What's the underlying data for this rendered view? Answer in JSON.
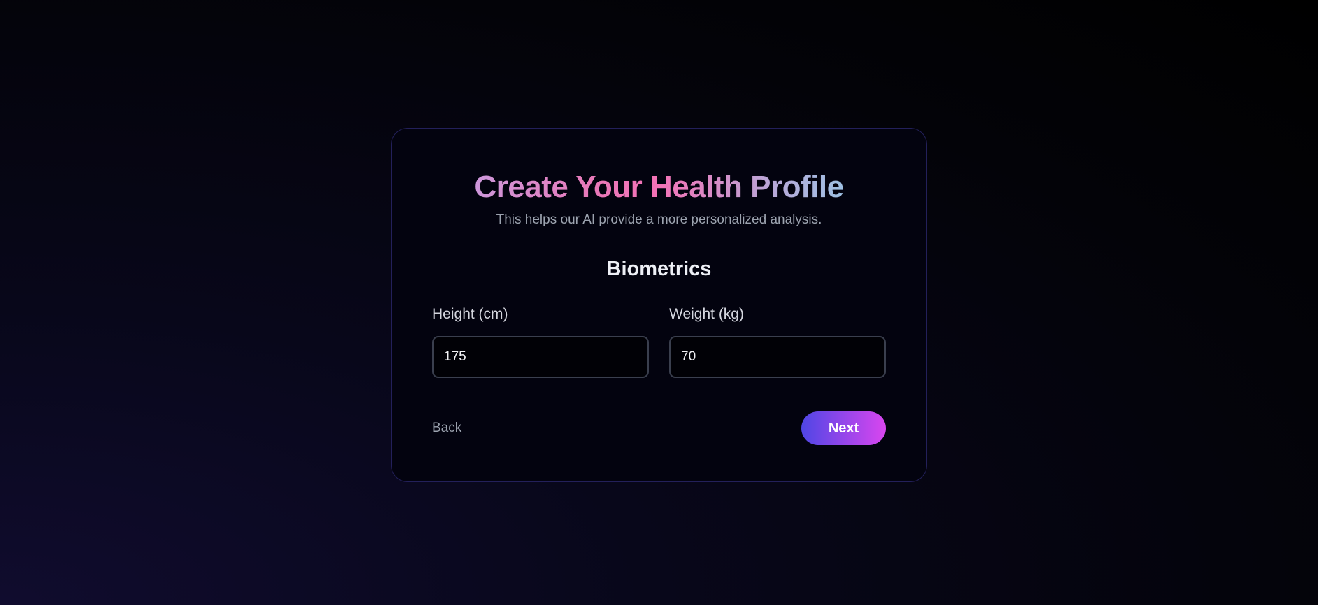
{
  "header": {
    "title": "Create Your Health Profile",
    "subtitle": "This helps our AI provide a more personalized analysis."
  },
  "section": {
    "title": "Biometrics"
  },
  "fields": [
    {
      "label": "Height (cm)",
      "value": "175"
    },
    {
      "label": "Weight (kg)",
      "value": "70"
    }
  ],
  "actions": {
    "back_label": "Back",
    "next_label": "Next"
  }
}
